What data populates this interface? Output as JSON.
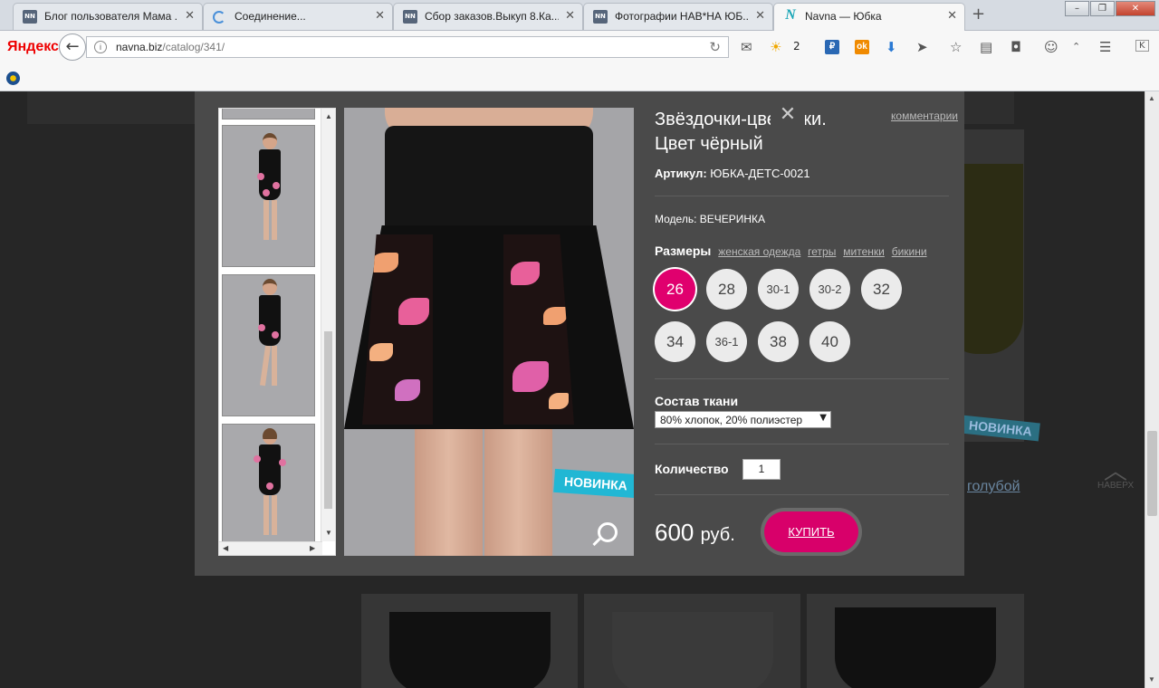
{
  "browser": {
    "tabs": [
      {
        "icon": "NN",
        "title": "Блог пользователя Мама ..."
      },
      {
        "icon": "",
        "title": "Соединение..."
      },
      {
        "icon": "NN",
        "title": "Сбор заказов.Выкуп 8.Ка..."
      },
      {
        "icon": "NN",
        "title": "Фотографии НАВ*НА ЮБ..."
      },
      {
        "icon": "N",
        "title": "Navna — Юбка"
      }
    ],
    "logo": "Яндекс",
    "url_host": "navna.biz",
    "url_path": "/catalog/341/",
    "weather_count": "2"
  },
  "background": {
    "link_text": "голубой",
    "badge": "НОВИНКА",
    "to_top": "НАВЕРХ"
  },
  "product": {
    "title": "Звёздочки-цветочки. Цвет чёрный",
    "comments_link": "комментарии",
    "article_label": "Артикул:",
    "article_value": "ЮБКА-ДЕТС-0021",
    "model_label": "Модель:",
    "model_value": "ВЕЧЕРИНКА",
    "sizes_label": "Размеры",
    "size_links": [
      "женская одежда",
      "гетры",
      "митенки",
      "бикини"
    ],
    "sizes": [
      "26",
      "28",
      "30-1",
      "30-2",
      "32",
      "34",
      "36-1",
      "38",
      "40"
    ],
    "selected_size": "26",
    "fabric_label": "Состав ткани",
    "fabric_value": "80% хлопок, 20% полиэстер",
    "qty_label": "Количество",
    "qty_value": "1",
    "price_value": "600",
    "price_currency": "руб.",
    "buy_label": "КУПИТЬ",
    "badge": "НОВИНКА"
  },
  "colors": {
    "accent": "#e0006e",
    "badge": "#21b7d4",
    "modal_bg": "#4a4a4a"
  }
}
